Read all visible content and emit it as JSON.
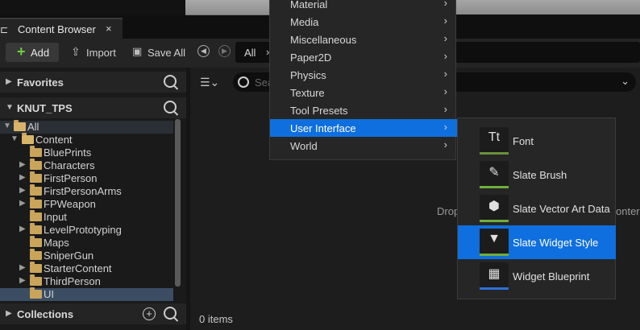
{
  "tab": {
    "title": "Content Browser",
    "close": "×"
  },
  "toolbar": {
    "add_label": "Add",
    "import_label": "Import",
    "saveall_label": "Save All",
    "path_root": "All",
    "path_arrow": "›"
  },
  "favorites": {
    "label": "Favorites"
  },
  "project": {
    "label": "KNUT_TPS"
  },
  "collections": {
    "label": "Collections"
  },
  "tree": [
    {
      "label": "All",
      "arrow": "▼",
      "open": true
    },
    {
      "label": "Content",
      "arrow": "▼",
      "open": true
    },
    {
      "label": "BluePrints",
      "arrow": ""
    },
    {
      "label": "Characters",
      "arrow": "▶"
    },
    {
      "label": "FirstPerson",
      "arrow": "▶"
    },
    {
      "label": "FirstPersonArms",
      "arrow": "▶"
    },
    {
      "label": "FPWeapon",
      "arrow": "▶"
    },
    {
      "label": "Input",
      "arrow": ""
    },
    {
      "label": "LevelPrototyping",
      "arrow": "▶"
    },
    {
      "label": "Maps",
      "arrow": ""
    },
    {
      "label": "SniperGun",
      "arrow": ""
    },
    {
      "label": "StarterContent",
      "arrow": "▶"
    },
    {
      "label": "ThirdPerson",
      "arrow": "▶"
    },
    {
      "label": "UI",
      "arrow": ""
    }
  ],
  "main": {
    "search_placeholder": "Sea",
    "drop_text": "Drop",
    "drop_text_right": "onter",
    "items_count": "0 items"
  },
  "category_menu": [
    {
      "label": "Material"
    },
    {
      "label": "Media"
    },
    {
      "label": "Miscellaneous"
    },
    {
      "label": "Paper2D"
    },
    {
      "label": "Physics"
    },
    {
      "label": "Texture"
    },
    {
      "label": "Tool Presets"
    },
    {
      "label": "User Interface",
      "selected": true
    },
    {
      "label": "World"
    }
  ],
  "submenu": [
    {
      "label": "Font",
      "icon": "font-icon",
      "glyph": "Tt",
      "bar": "#6b8f3a"
    },
    {
      "label": "Slate Brush",
      "icon": "slate-brush-icon",
      "glyph": "✎",
      "bar": "#6fae3c"
    },
    {
      "label": "Slate Vector Art Data",
      "icon": "vector-art-icon",
      "glyph": "⬢",
      "bar": "#6fae3c"
    },
    {
      "label": "Slate Widget Style",
      "icon": "widget-style-icon",
      "glyph": "▼",
      "bar": "#6fae3c",
      "selected": true
    },
    {
      "label": "Widget Blueprint",
      "icon": "widget-blueprint-icon",
      "glyph": "▦",
      "bar": "#2f6fd6"
    }
  ],
  "colors": {
    "accent": "#0f6fde",
    "folder": "#c9a45a",
    "add_plus": "#6fcf3f"
  }
}
